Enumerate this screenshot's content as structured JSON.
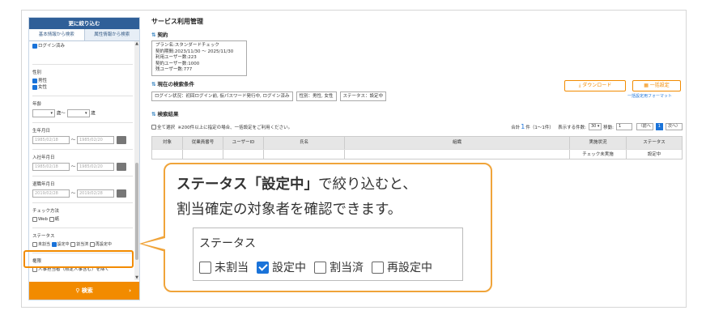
{
  "sidebar": {
    "header": "更に絞り込む",
    "tabs": [
      "基本情報から検索",
      "属性情報から検索"
    ],
    "login_checked": "ログイン済み",
    "gender_title": "性別",
    "gender_opts": [
      "男性",
      "女性"
    ],
    "age_title": "年齢",
    "age_from_suffix": "歳〜",
    "age_to_suffix": "歳",
    "birth_title": "生年月日",
    "birth_from": "1985/02/18",
    "birth_to": "1985/02/20",
    "join_title": "入社年月日",
    "join_from": "1985/02/18",
    "join_to": "1985/02/20",
    "leave_title": "退職年月日",
    "leave_from": "2019/02/28",
    "leave_to": "2019/02/28",
    "check_title": "チェック方法",
    "check_opts": [
      "Web",
      "紙"
    ],
    "status_title": "ステータス",
    "status_opts": [
      "未割当",
      "設定中",
      "割当済",
      "再設定中"
    ],
    "perm_title": "権限",
    "perm_opt": "人事担当者（限定人事含む）を除く",
    "search_label": "検索",
    "search_chev": "›"
  },
  "main": {
    "title": "サービス利用管理",
    "contract_title": "契約",
    "contract_lines": [
      "プラン名:スタンダードチェック",
      "契約期間:2023/11/30 〜 2025/11/30",
      "利用ユーザー数:223",
      "契約ユーザー数:1000",
      "残ユーザー数:777"
    ],
    "download_label": "ダウンロード",
    "bulk_label": "一括設定",
    "bulk_fmt": "一括設定用フォーマット",
    "cond_title": "現在の検索条件",
    "chips": [
      "ログイン状況：初回ログイン前, 仮パスワード発行中, ログイン済み",
      "性別：男性, 女性",
      "ステータス：設定中"
    ],
    "results_title": "検索結果",
    "select_all": "全て選択",
    "note": "※200件以上に指定の場合、一括設定をご利用ください。",
    "total_pre": "合計",
    "total_count": "1",
    "total_post": "件（1〜1件）",
    "per_page_label": "表示する件数:",
    "per_page": "30",
    "jump_label": "移動:",
    "jump_val": "1",
    "prev": "〈前へ",
    "page": "1",
    "next": "次へ〉",
    "columns": [
      "対象",
      "従業員番号",
      "ユーザーID",
      "氏名",
      "組織",
      "実施状況",
      "ステータス"
    ],
    "row": [
      "",
      "",
      "",
      "",
      "",
      "チェック未実施",
      "設定中"
    ]
  },
  "callout": {
    "line1_bold": "ステータス「設定中」",
    "line1_rest": "で絞り込むと、",
    "line2": "割当確定の対象者を確認できます。",
    "label": "ステータス",
    "opts": [
      "未割当",
      "設定中",
      "割当済",
      "再設定中"
    ]
  }
}
